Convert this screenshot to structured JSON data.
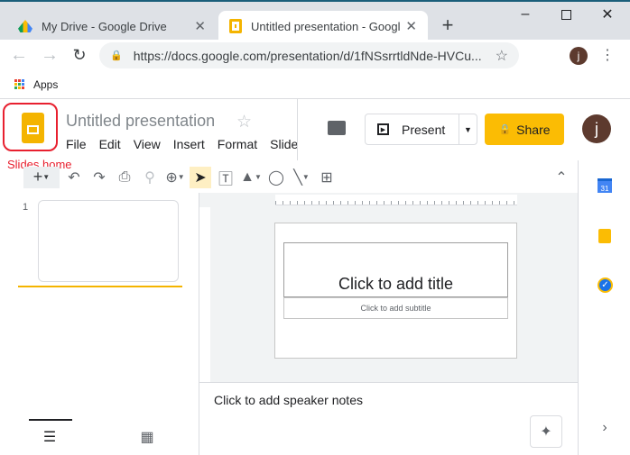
{
  "browser": {
    "tabs": [
      {
        "title": "My Drive - Google Drive",
        "icon": "google-drive-icon"
      },
      {
        "title": "Untitled presentation - Google Slides",
        "icon": "slides-icon",
        "active": true
      }
    ],
    "url": "https://docs.google.com/presentation/d/1fNSsrrtldNde-HVCu...",
    "bookmarks": [
      {
        "label": "Apps"
      }
    ],
    "profile_initial": "j"
  },
  "app": {
    "title": "Untitled presentation",
    "menu": [
      "File",
      "Edit",
      "View",
      "Insert",
      "Format",
      "Slide"
    ],
    "present_label": "Present",
    "share_label": "Share",
    "avatar_initial": "j",
    "annotation": "Slides home",
    "accent": "#fbbc04"
  },
  "filmstrip": {
    "slide_number": "1"
  },
  "slide": {
    "title_placeholder": "Click to add title",
    "subtitle_placeholder": "Click to add subtitle"
  },
  "notes": {
    "placeholder": "Click to add speaker notes"
  },
  "side_panel": {
    "calendar_day": "31"
  }
}
